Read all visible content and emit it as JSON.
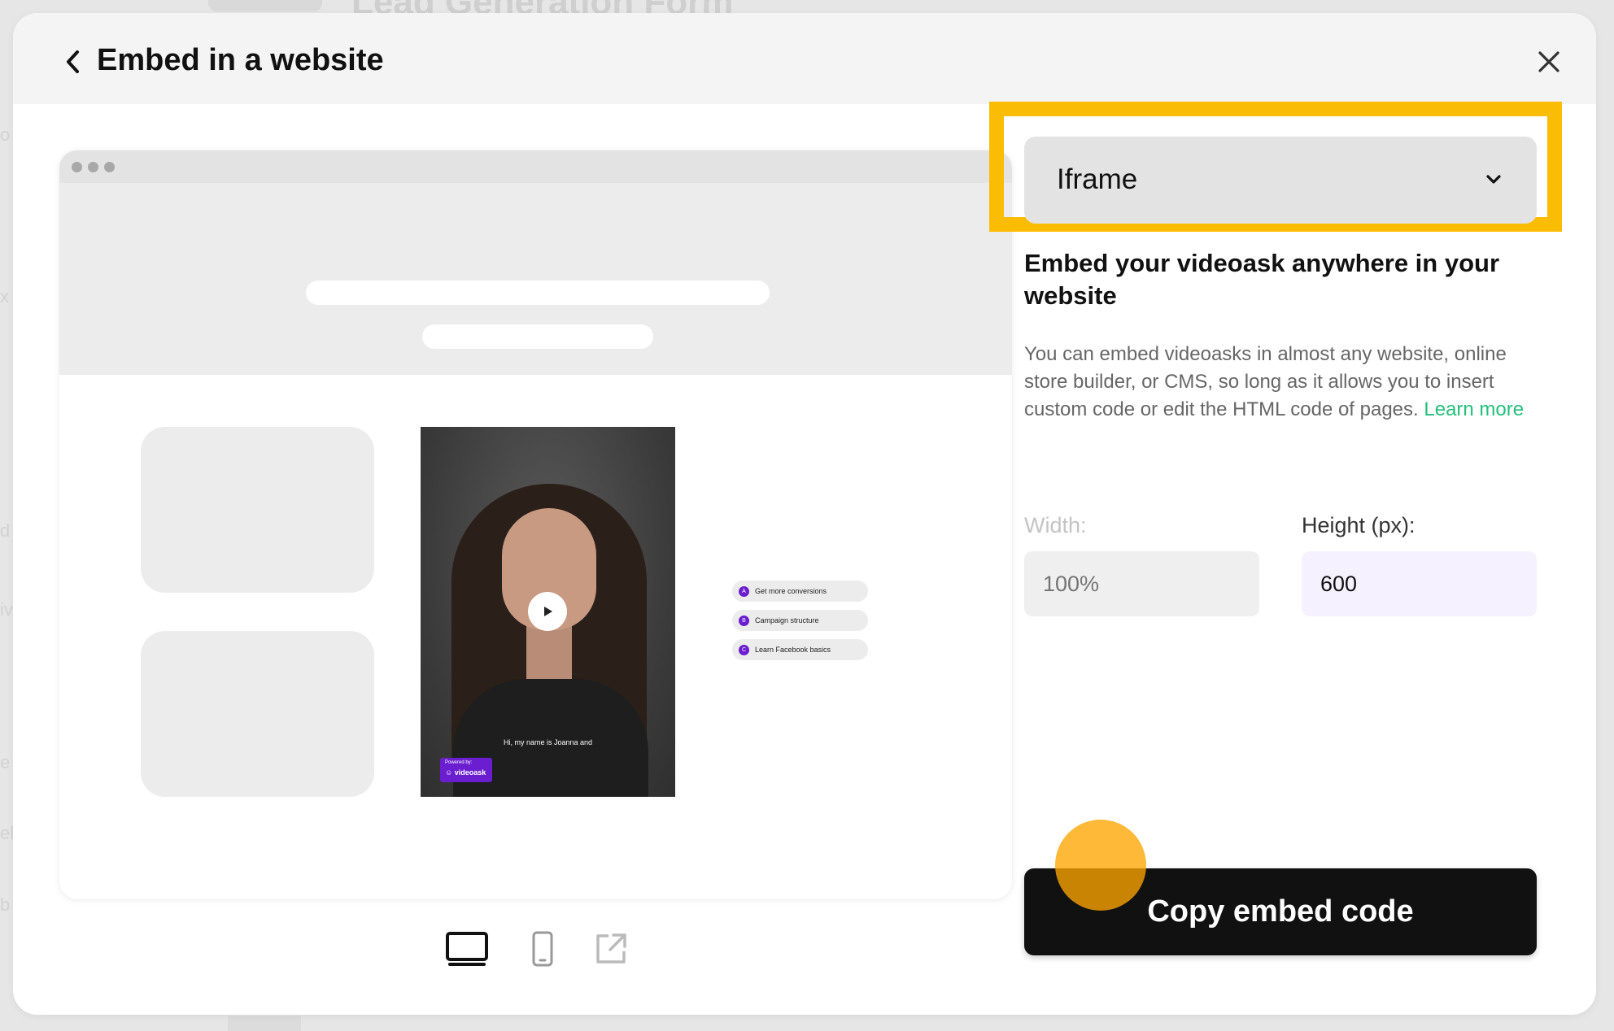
{
  "backdrop": {
    "page_title": "Lead Generation Form",
    "side_letters": [
      "o",
      "x",
      "d",
      "iv",
      "e",
      "el",
      "b"
    ]
  },
  "modal": {
    "title": "Embed in a website",
    "back_icon": "chevron-left-icon",
    "close_icon": "close-icon"
  },
  "preview": {
    "video": {
      "caption": "Hi, my name is Joanna and",
      "powered_by_label": "Powered by:",
      "brand": "videoask"
    },
    "answers": [
      {
        "letter": "A",
        "label": "Get more conversions"
      },
      {
        "letter": "B",
        "label": "Campaign structure"
      },
      {
        "letter": "C",
        "label": "Learn Facebook basics"
      }
    ],
    "view_modes": [
      {
        "name": "desktop-view-icon",
        "selected": true
      },
      {
        "name": "mobile-view-icon",
        "selected": false
      },
      {
        "name": "open-external-icon",
        "selected": false
      }
    ]
  },
  "panel": {
    "embed_type": {
      "selected": "Iframe",
      "icon": "chevron-down-icon"
    },
    "heading": "Embed your videoask anywhere in your website",
    "description": "You can embed videoasks in almost any website, online store builder, or CMS, so long as it allows you to insert custom code or edit the HTML code of pages.",
    "learn_more": "Learn more",
    "width": {
      "label": "Width:",
      "placeholder": "100%"
    },
    "height": {
      "label": "Height (px):",
      "value": "600"
    },
    "copy_button": "Copy embed code"
  },
  "colors": {
    "highlight": "#fbbc05",
    "brand_purple": "#6a1ed0",
    "link_green": "#23c07a",
    "primary_button": "#111111"
  }
}
